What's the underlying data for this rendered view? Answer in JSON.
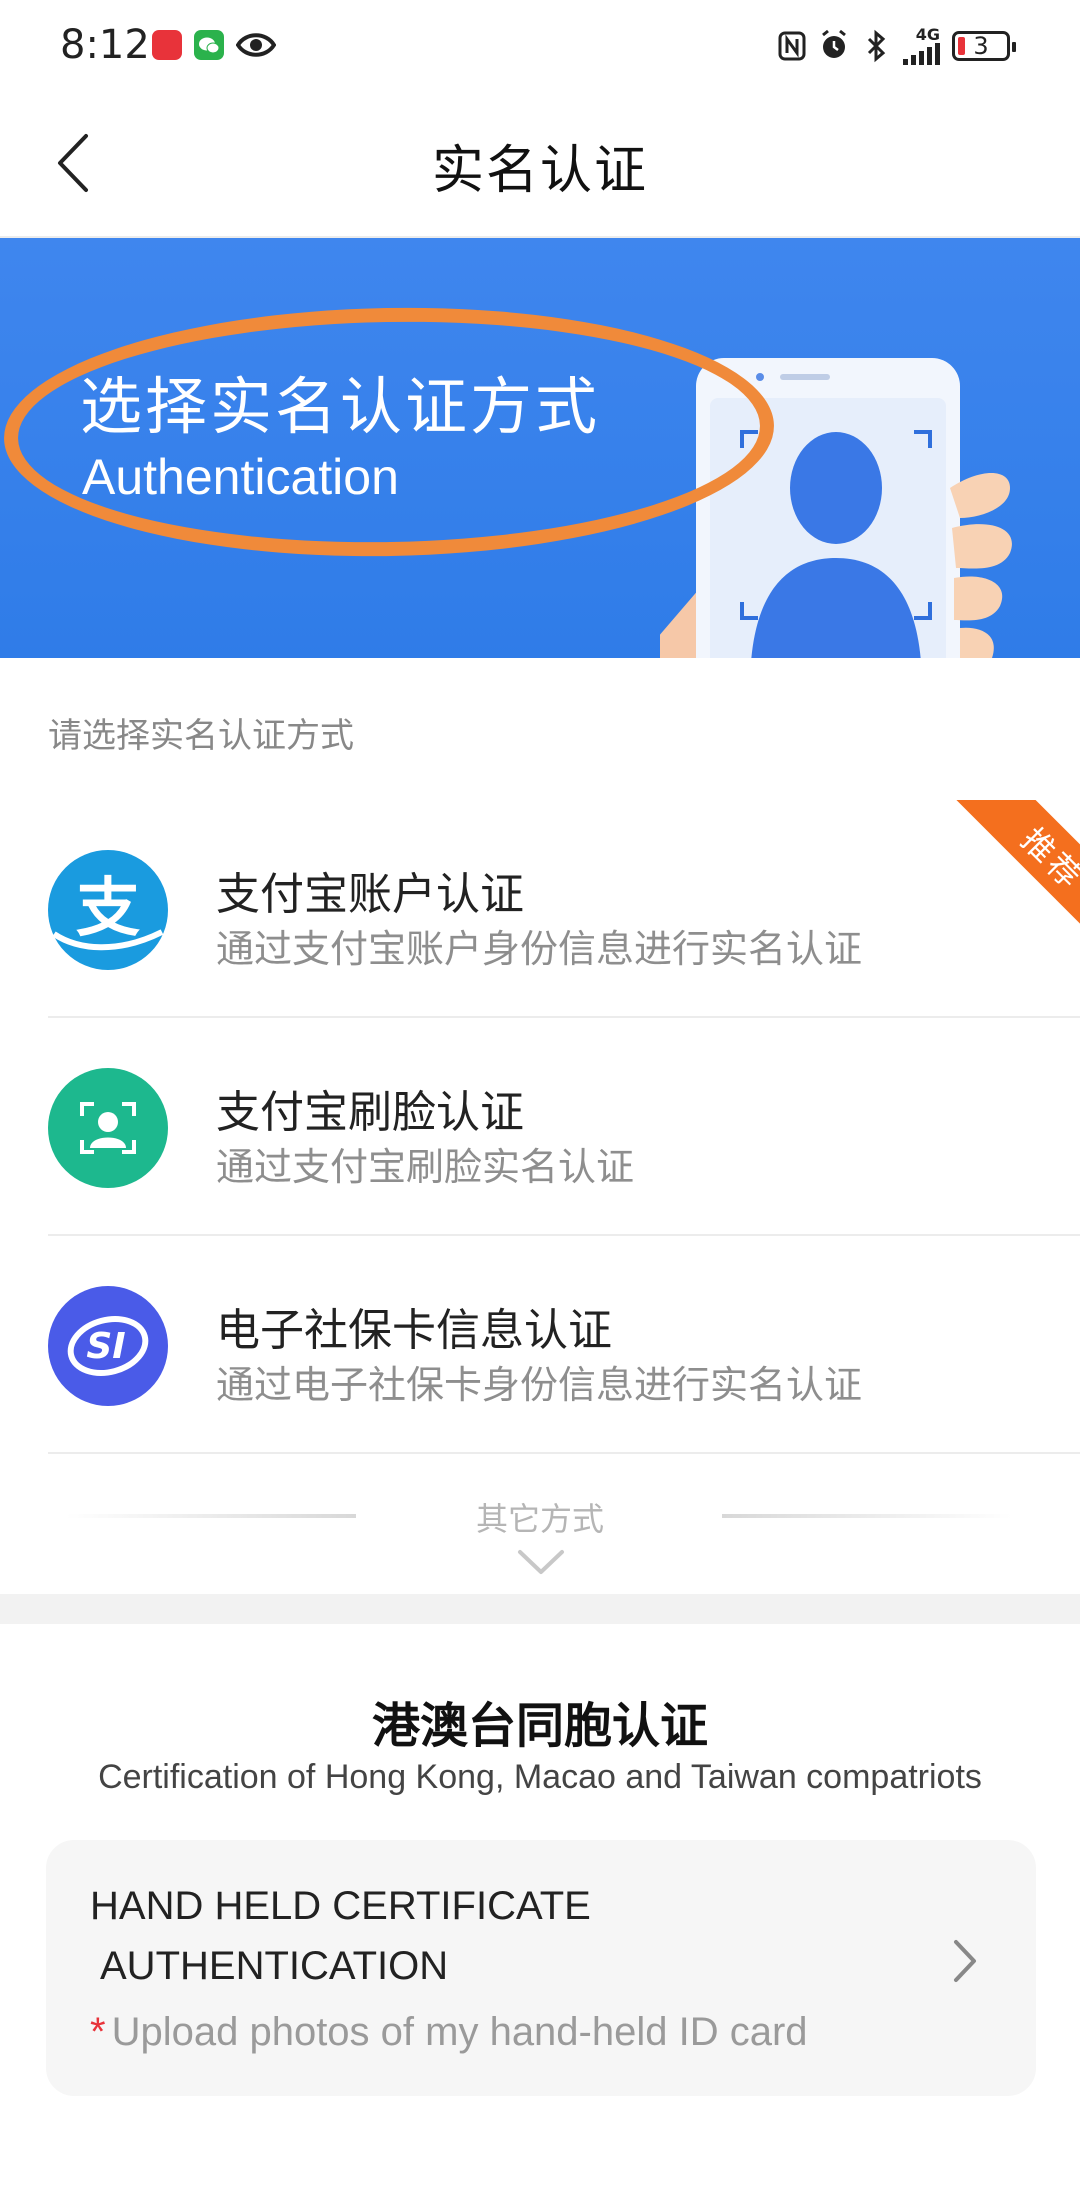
{
  "status_bar": {
    "time": "8:12",
    "network": "4G",
    "battery_level": "3"
  },
  "header": {
    "title": "实名认证"
  },
  "banner": {
    "title": "选择实名认证方式",
    "subtitle": "Authentication"
  },
  "section_label": "请选择实名认证方式",
  "methods": [
    {
      "title": "支付宝账户认证",
      "desc": "通过支付宝账户身份信息进行实名认证",
      "icon": "alipay-icon",
      "badge": "推荐",
      "color": "#1a9bdf"
    },
    {
      "title": "支付宝刷脸认证",
      "desc": "通过支付宝刷脸实名认证",
      "icon": "face-scan-icon",
      "color": "#1db88e"
    },
    {
      "title": "电子社保卡信息认证",
      "desc": "通过电子社保卡身份信息进行实名认证",
      "icon": "social-security-icon",
      "color": "#4a5be8"
    }
  ],
  "other_ways": {
    "label": "其它方式"
  },
  "hk_section": {
    "title": "港澳台同胞认证",
    "subtitle": "Certification of Hong Kong, Macao and Taiwan compatriots",
    "card": {
      "title_line1": "HAND HELD CERTIFICATE",
      "title_line2": "AUTHENTICATION",
      "required_mark": "*",
      "note": "Upload photos of my hand-held ID card"
    }
  },
  "colors": {
    "banner_blue": "#3a82ec",
    "highlight_orange": "#f08a3a",
    "ribbon_orange": "#f46f1e"
  }
}
